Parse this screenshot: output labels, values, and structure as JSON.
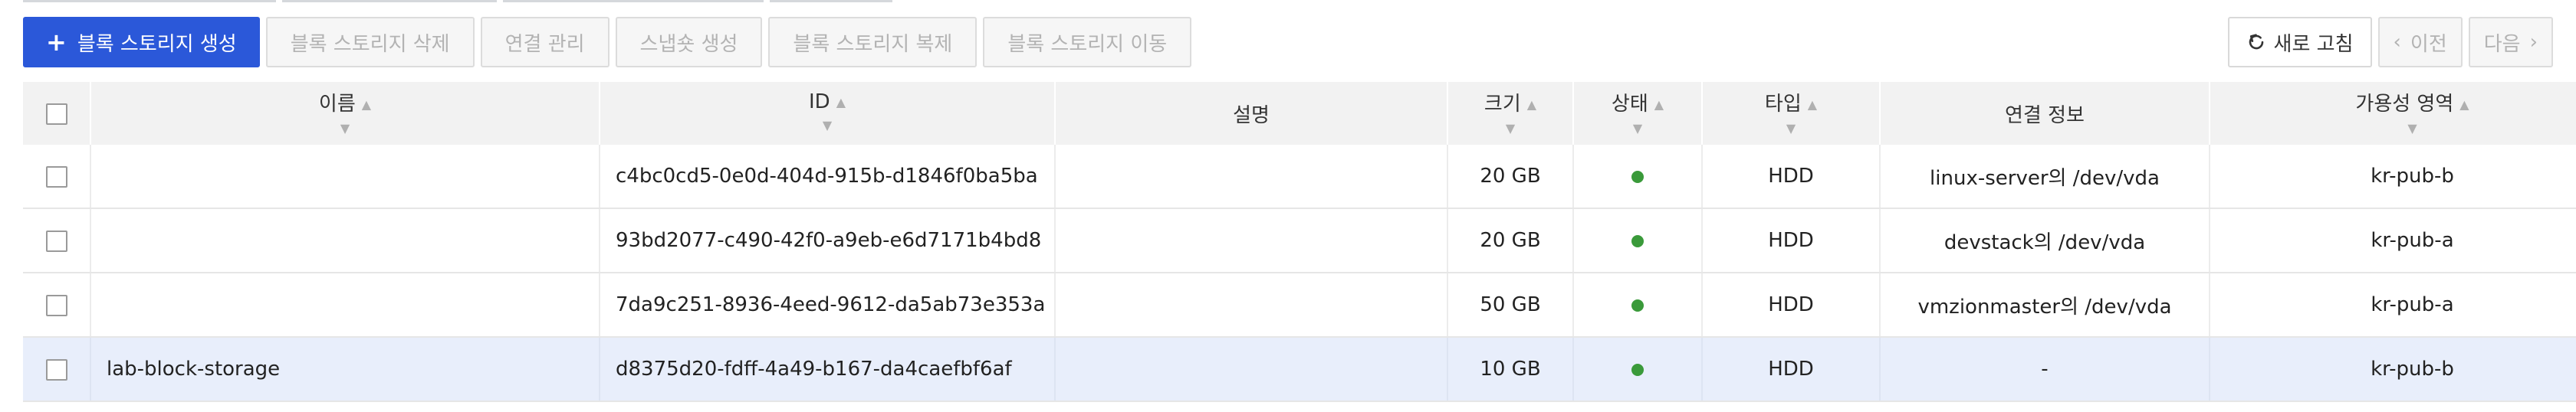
{
  "toolbar": {
    "create_label": "블록 스토리지 생성",
    "delete_label": "블록 스토리지 삭제",
    "connect_label": "연결 관리",
    "snapshot_label": "스냅숏 생성",
    "clone_label": "블록 스토리지 복제",
    "move_label": "블록 스토리지 이동",
    "refresh_label": "새로 고침",
    "prev_label": "이전",
    "next_label": "다음"
  },
  "table": {
    "headers": {
      "name": "이름",
      "id": "ID",
      "description": "설명",
      "size": "크기",
      "status": "상태",
      "type": "타입",
      "connection": "연결 정보",
      "zone": "가용성 영역"
    },
    "rows": [
      {
        "name": "",
        "id": "c4bc0cd5-0e0d-404d-915b-d1846f0ba5ba",
        "description": "",
        "size": "20 GB",
        "type": "HDD",
        "connection": "linux-server의 /dev/vda",
        "zone": "kr-pub-b"
      },
      {
        "name": "",
        "id": "93bd2077-c490-42f0-a9eb-e6d7171b4bd8",
        "description": "",
        "size": "20 GB",
        "type": "HDD",
        "connection": "devstack의 /dev/vda",
        "zone": "kr-pub-a"
      },
      {
        "name": "",
        "id": "7da9c251-8936-4eed-9612-da5ab73e353a",
        "description": "",
        "size": "50 GB",
        "type": "HDD",
        "connection": "vmzionmaster의 /dev/vda",
        "zone": "kr-pub-a"
      },
      {
        "name": "lab-block-storage",
        "id": "d8375d20-fdff-4a49-b167-da4caefbf6af",
        "description": "",
        "size": "10 GB",
        "type": "HDD",
        "connection": "-",
        "zone": "kr-pub-b"
      }
    ]
  },
  "colors": {
    "primary": "#2b58d9",
    "status_ok": "#3a9a3a",
    "selected_row": "#e8eefb"
  },
  "icons": {
    "add": "plus-icon",
    "refresh": "refresh-icon",
    "prev": "chevron-left-icon",
    "next": "chevron-right-icon",
    "sort": "sort-icon",
    "status": "status-dot-icon"
  }
}
